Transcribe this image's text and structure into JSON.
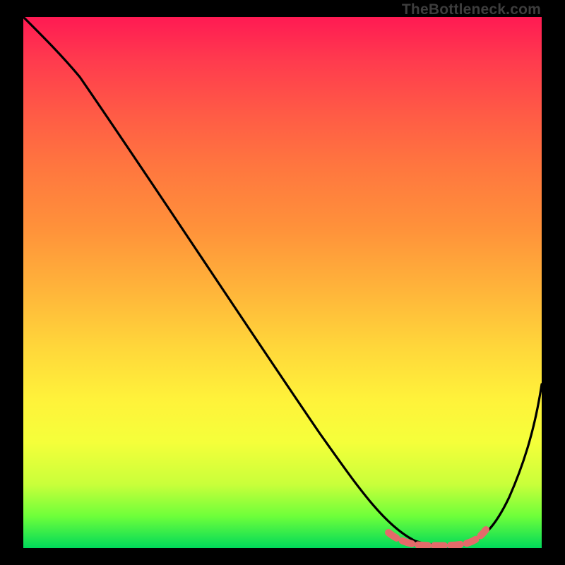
{
  "attribution": "TheBottleneck.com",
  "colors": {
    "curve": "#000000",
    "highlight": "#e46a6a",
    "frame_bg": "#000000"
  },
  "chart_data": {
    "type": "line",
    "title": "",
    "xlabel": "",
    "ylabel": "",
    "xlim": [
      0,
      100
    ],
    "ylim": [
      0,
      100
    ],
    "x": [
      0,
      5,
      10,
      15,
      20,
      25,
      30,
      35,
      40,
      45,
      50,
      55,
      60,
      65,
      70,
      75,
      80,
      85,
      90,
      95,
      100
    ],
    "values": [
      99.5,
      97.0,
      92.0,
      85.5,
      79.0,
      71.5,
      64.0,
      57.0,
      49.5,
      42.0,
      34.5,
      27.0,
      19.5,
      12.0,
      5.5,
      1.5,
      0.5,
      1.0,
      7.0,
      19.0,
      35.5
    ],
    "highlight_range": {
      "x_start": 70,
      "x_end": 87,
      "note": "flat minimum zone, highlighted in red"
    }
  }
}
